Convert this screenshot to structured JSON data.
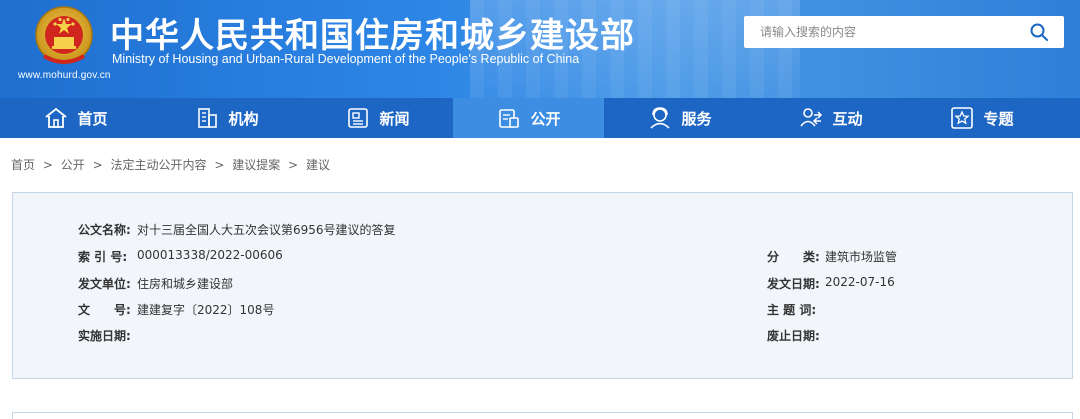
{
  "header": {
    "site_url": "www.mohurd.gov.cn",
    "title_cn": "中华人民共和国住房和城乡建设部",
    "title_en": "Ministry of Housing and Urban-Rural Development of the People's Republic of China",
    "search_placeholder": "请输入搜索的内容",
    "icon": "search-icon"
  },
  "nav": {
    "items": [
      {
        "label": "首页",
        "icon": "home-icon"
      },
      {
        "label": "机构",
        "icon": "building-icon"
      },
      {
        "label": "新闻",
        "icon": "newspaper-icon"
      },
      {
        "label": "公开",
        "icon": "document-icon",
        "active": true
      },
      {
        "label": "服务",
        "icon": "service-icon"
      },
      {
        "label": "互动",
        "icon": "interaction-icon"
      },
      {
        "label": "专题",
        "icon": "star-icon"
      }
    ]
  },
  "breadcrumb": [
    "首页",
    "公开",
    "法定主动公开内容",
    "建议提案",
    "建议"
  ],
  "breadcrumb_sep": ">",
  "meta": {
    "doc_name_label": "公文名称:",
    "doc_name": "对十三届全国人大五次会议第6956号建议的答复",
    "index_label": "索 引 号:",
    "index": "000013338/2022-00606",
    "category_label": "分　　类:",
    "category": "建筑市场监管",
    "issuer_label": "发文单位:",
    "issuer": "住房和城乡建设部",
    "issue_date_label": "发文日期:",
    "issue_date": "2022-07-16",
    "doc_no_label": "文　　号:",
    "doc_no": "建建复字〔2022〕108号",
    "subject_label": "主 题 词:",
    "subject": "",
    "effective_label": "实施日期:",
    "effective": "",
    "expiry_label": "废止日期:",
    "expiry": ""
  },
  "colors": {
    "banner": "#2d86e6",
    "nav": "#1d66c4",
    "nav_active": "#3d8ee3",
    "meta_bg": "#f2f6fb"
  }
}
